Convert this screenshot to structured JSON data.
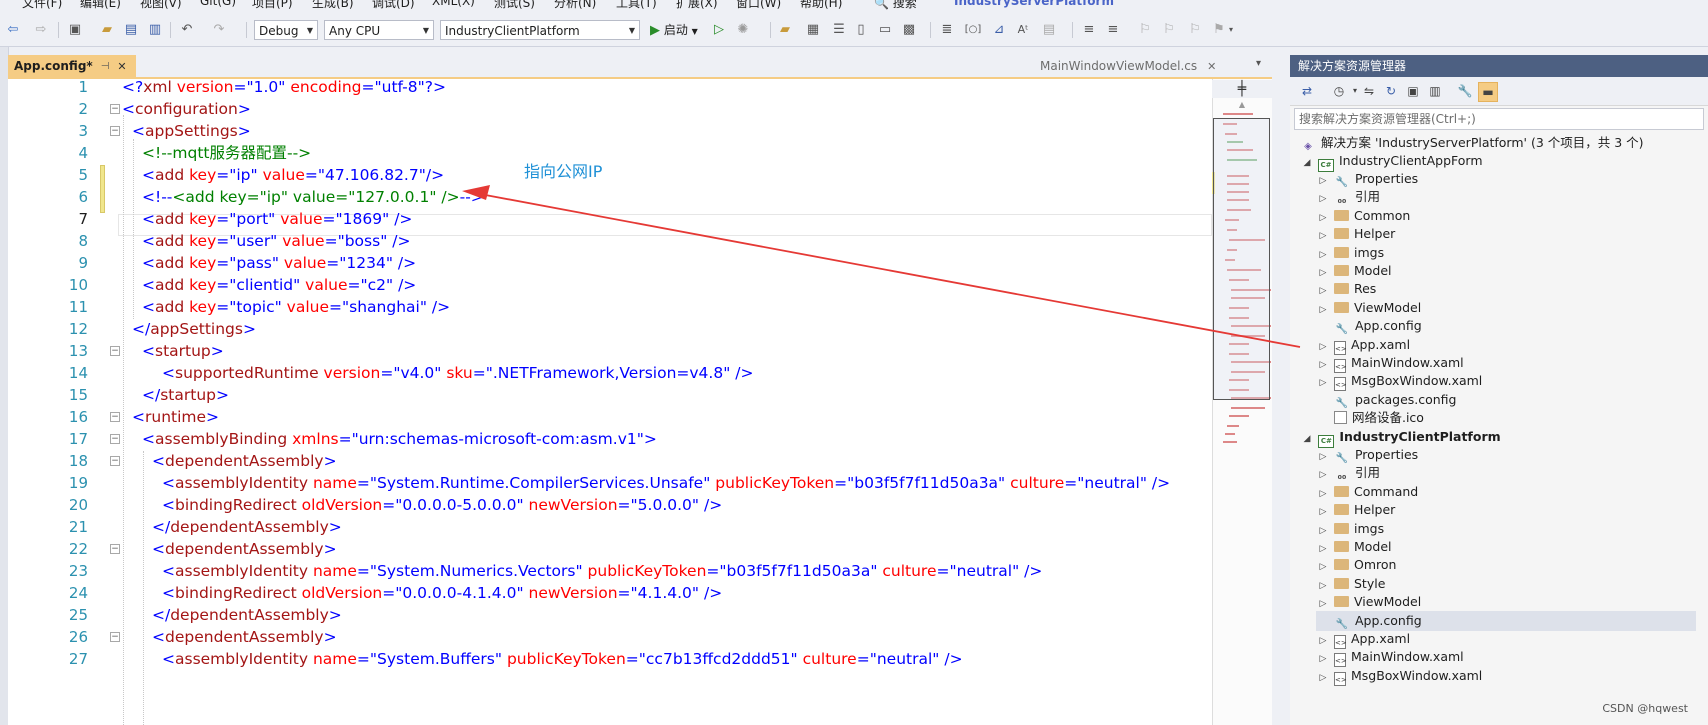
{
  "menu": {
    "items": [
      "文件(F)",
      "编辑(E)",
      "视图(V)",
      "Git(G)",
      "项目(P)",
      "生成(B)",
      "调试(D)",
      "XML(X)",
      "测试(S)",
      "分析(N)",
      "工具(T)",
      "扩展(X)",
      "窗口(W)",
      "帮助(H)"
    ],
    "search_label": "搜索",
    "solution_name": "IndustryServerPlatform"
  },
  "toolbar": {
    "config_value": "Debug",
    "platform_value": "Any CPU",
    "project_value": "IndustryClientPlatform",
    "start_label": "启动"
  },
  "editor": {
    "active_tab": "App.config*",
    "other_tab": "MainWindowViewModel.cs",
    "annotation": "指向公网IP",
    "current_line": 7,
    "line_numbers": [
      "1",
      "2",
      "3",
      "4",
      "5",
      "6",
      "7",
      "8",
      "9",
      "10",
      "11",
      "12",
      "13",
      "14",
      "15",
      "16",
      "17",
      "18",
      "19",
      "20",
      "21",
      "22",
      "23",
      "24",
      "25",
      "26",
      "27"
    ]
  },
  "code": {
    "l1": {
      "open": "<?",
      "tag": "xml",
      "a1": " version",
      "v1": "\"1.0\"",
      "a2": " encoding",
      "v2": "\"utf-8\"",
      "close": "?>"
    },
    "l2": {
      "open": "<",
      "tag": "configuration",
      "close": ">"
    },
    "l3": {
      "open": "<",
      "tag": "appSettings",
      "close": ">"
    },
    "l4": {
      "comment": "<!--mqtt服务器配置-->"
    },
    "l5": {
      "open": "<",
      "tag": "add",
      "a1": " key",
      "v1": "\"ip\"",
      "a2": " value",
      "v2": "\"47.106.82.7\"",
      "close": "/>"
    },
    "l6": {
      "c_open": "<!--",
      "comment": "<add key=\"ip\" value=\"127.0.0.1\" />",
      "c_close": "-->"
    },
    "l7": {
      "open": "<",
      "tag": "add",
      "a1": " key",
      "v1": "\"port\"",
      "a2": " value",
      "v2": "\"1869\"",
      "close": " />"
    },
    "l8": {
      "open": "<",
      "tag": "add",
      "a1": " key",
      "v1": "\"user\"",
      "a2": " value",
      "v2": "\"boss\"",
      "close": " />"
    },
    "l9": {
      "open": "<",
      "tag": "add",
      "a1": " key",
      "v1": "\"pass\"",
      "a2": " value",
      "v2": "\"1234\"",
      "close": " />"
    },
    "l10": {
      "open": "<",
      "tag": "add",
      "a1": " key",
      "v1": "\"clientid\"",
      "a2": " value",
      "v2": "\"c2\"",
      "close": " />"
    },
    "l11": {
      "open": "<",
      "tag": "add",
      "a1": " key",
      "v1": "\"topic\"",
      "a2": " value",
      "v2": "\"shanghai\"",
      "close": " />"
    },
    "l12": {
      "open": "</",
      "tag": "appSettings",
      "close": ">"
    },
    "l13": {
      "open": "<",
      "tag": "startup",
      "close": ">"
    },
    "l14": {
      "open": "<",
      "tag": "supportedRuntime",
      "a1": " version",
      "v1": "\"v4.0\"",
      "a2": " sku",
      "v2": "\".NETFramework,Version=v4.8\"",
      "close": " />"
    },
    "l15": {
      "open": "</",
      "tag": "startup",
      "close": ">"
    },
    "l16": {
      "open": "<",
      "tag": "runtime",
      "close": ">"
    },
    "l17": {
      "open": "<",
      "tag": "assemblyBinding",
      "a1": " xmlns",
      "v1": "\"urn:schemas-microsoft-com:asm.v1\"",
      "close": ">"
    },
    "l18": {
      "open": "<",
      "tag": "dependentAssembly",
      "close": ">"
    },
    "l19": {
      "open": "<",
      "tag": "assemblyIdentity",
      "a1": " name",
      "v1": "\"System.Runtime.CompilerServices.Unsafe\"",
      "a2": " publicKeyToken",
      "v2": "\"b03f5f7f11d50a3a\"",
      "a3": " culture",
      "v3": "\"neutral\"",
      "close": " />"
    },
    "l20": {
      "open": "<",
      "tag": "bindingRedirect",
      "a1": " oldVersion",
      "v1": "\"0.0.0.0-5.0.0.0\"",
      "a2": " newVersion",
      "v2": "\"5.0.0.0\"",
      "close": " />"
    },
    "l21": {
      "open": "</",
      "tag": "dependentAssembly",
      "close": ">"
    },
    "l22": {
      "open": "<",
      "tag": "dependentAssembly",
      "close": ">"
    },
    "l23": {
      "open": "<",
      "tag": "assemblyIdentity",
      "a1": " name",
      "v1": "\"System.Numerics.Vectors\"",
      "a2": " publicKeyToken",
      "v2": "\"b03f5f7f11d50a3a\"",
      "a3": " culture",
      "v3": "\"neutral\"",
      "close": " />"
    },
    "l24": {
      "open": "<",
      "tag": "bindingRedirect",
      "a1": " oldVersion",
      "v1": "\"0.0.0.0-4.1.4.0\"",
      "a2": " newVersion",
      "v2": "\"4.1.4.0\"",
      "close": " />"
    },
    "l25": {
      "open": "</",
      "tag": "dependentAssembly",
      "close": ">"
    },
    "l26": {
      "open": "<",
      "tag": "dependentAssembly",
      "close": ">"
    },
    "l27": {
      "open": "<",
      "tag": "assemblyIdentity",
      "a1": " name",
      "v1": "\"System.Buffers\"",
      "a2": " publicKeyToken",
      "v2": "\"cc7b13ffcd2ddd51\"",
      "a3": " culture",
      "v3": "\"neutral\"",
      "close": " />"
    }
  },
  "solution_explorer": {
    "title": "解决方案资源管理器",
    "search_placeholder": "搜索解决方案资源管理器(Ctrl+;)",
    "solution_label": "解决方案 'IndustryServerPlatform' (3 个项目，共 3 个)",
    "project1": {
      "name": "IndustryClientAppForm",
      "items": [
        "Properties",
        "引用",
        "Common",
        "Helper",
        "imgs",
        "Model",
        "Res",
        "ViewModel",
        "App.config",
        "App.xaml",
        "MainWindow.xaml",
        "MsgBoxWindow.xaml",
        "packages.config",
        "网络设备.ico"
      ]
    },
    "project2": {
      "name": "IndustryClientPlatform",
      "items": [
        "Properties",
        "引用",
        "Command",
        "Helper",
        "imgs",
        "Model",
        "Omron",
        "Style",
        "ViewModel",
        "App.config",
        "App.xaml",
        "MainWindow.xaml",
        "MsgBoxWindow.xaml"
      ]
    }
  },
  "watermark": "CSDN @hqwest",
  "colors": {
    "tab_active": "#f5cc84",
    "se_title": "#4d6082",
    "annotation": "#1e90d6",
    "arrow": "#e53935"
  }
}
